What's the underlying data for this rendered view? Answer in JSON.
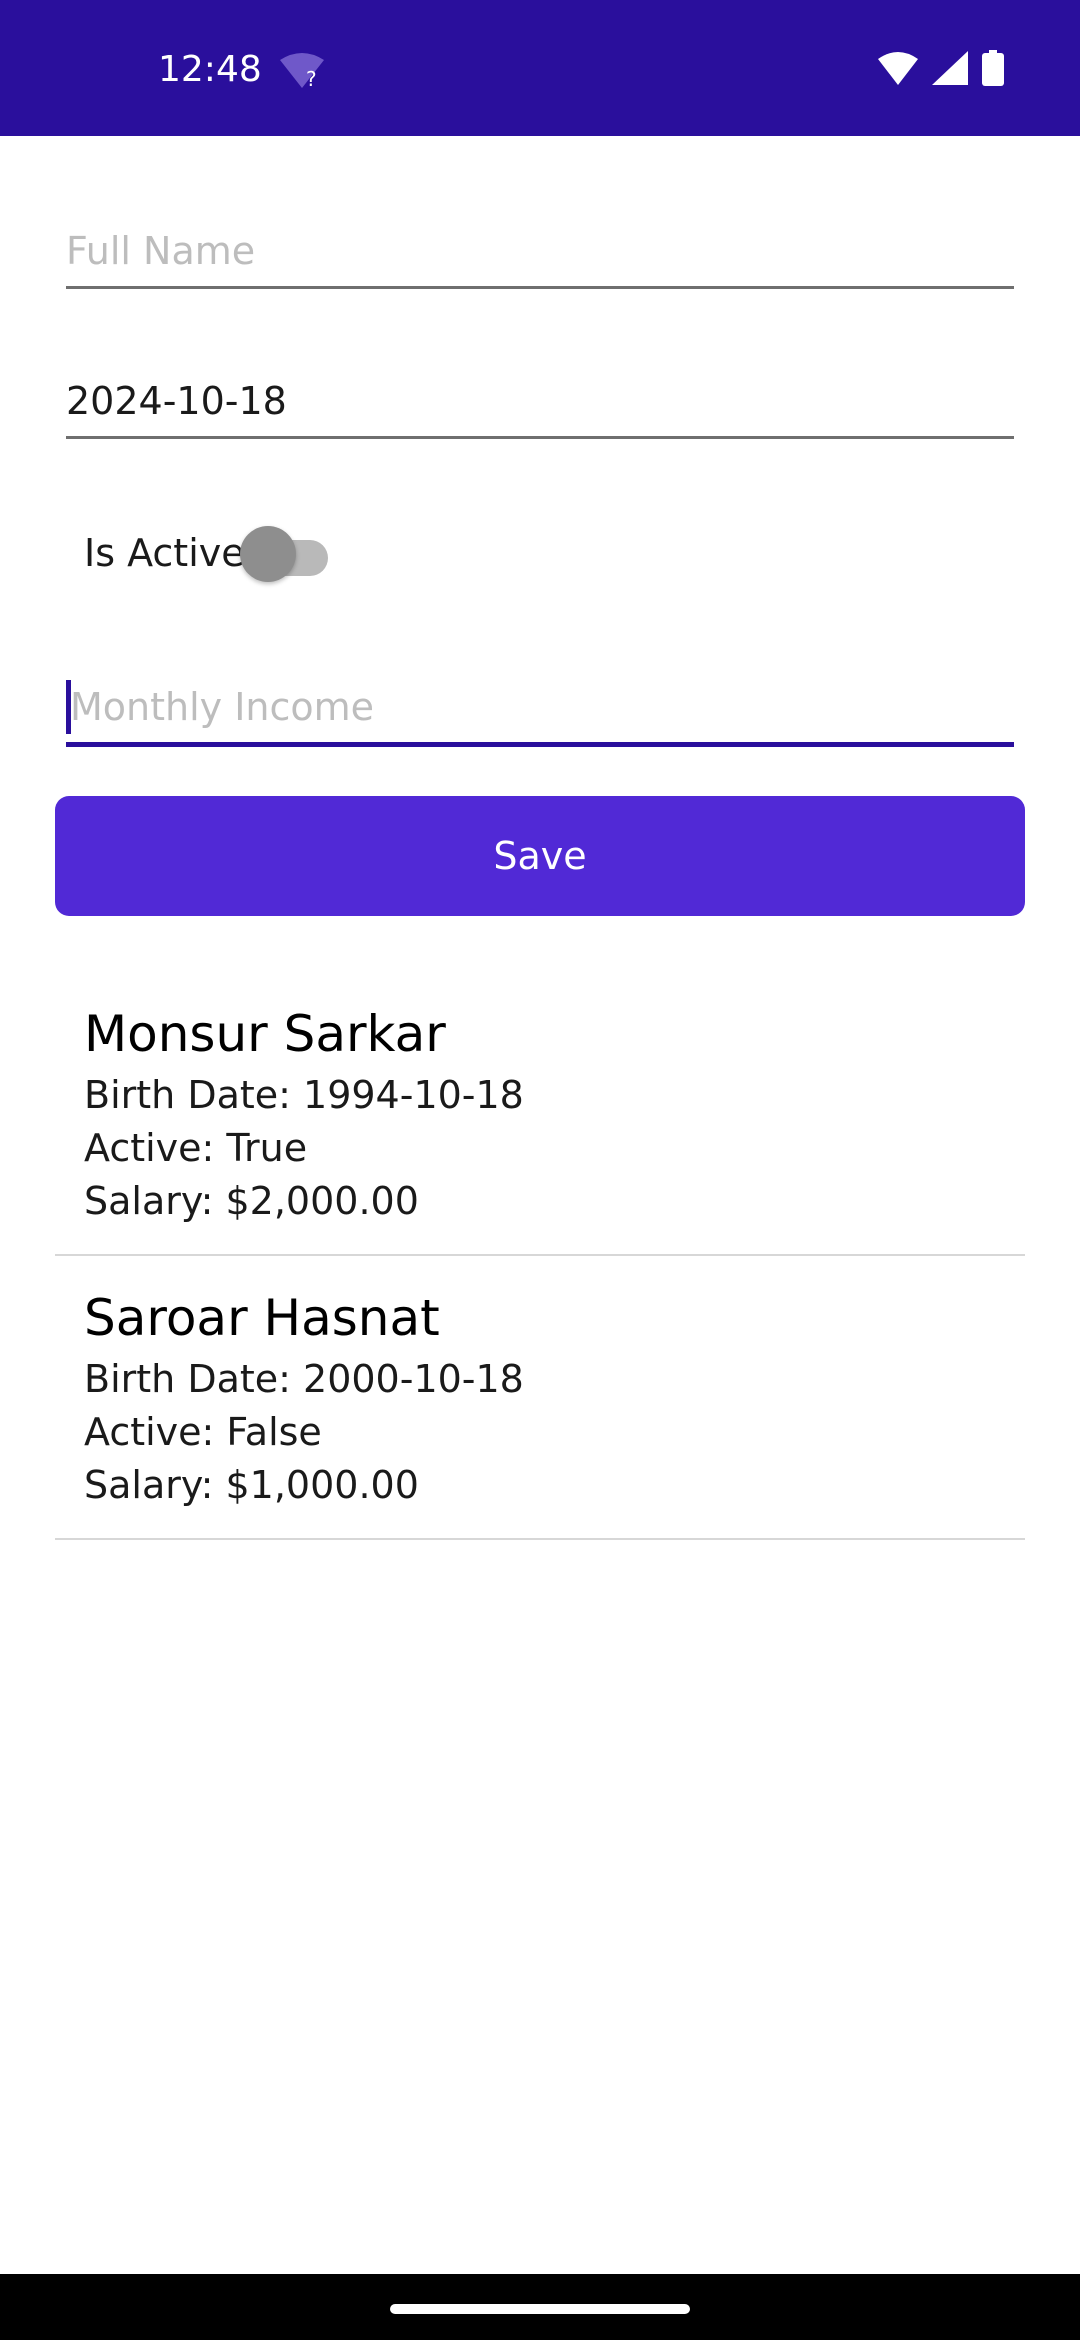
{
  "status_bar": {
    "time": "12:48",
    "wifi_question_icon": "wifi-question-icon",
    "wifi_icon": "wifi-icon",
    "signal_icon": "signal-icon",
    "battery_icon": "battery-icon",
    "background_color": "#2a0f9c"
  },
  "form": {
    "full_name": {
      "placeholder": "Full Name",
      "value": ""
    },
    "birth_date": {
      "value": "2024-10-18"
    },
    "is_active": {
      "label": "Is Active",
      "checked": false
    },
    "monthly_income": {
      "placeholder": "Monthly Income",
      "value": "",
      "focused": true
    },
    "save_label": "Save",
    "accent_color": "#5129d6"
  },
  "people": [
    {
      "name": "Monsur Sarkar",
      "birth_date": "Birth Date: 1994-10-18",
      "active": "Active: True",
      "salary": "Salary: $2,000.00"
    },
    {
      "name": "Saroar Hasnat",
      "birth_date": "Birth Date: 2000-10-18",
      "active": "Active: False",
      "salary": "Salary: $1,000.00"
    }
  ]
}
